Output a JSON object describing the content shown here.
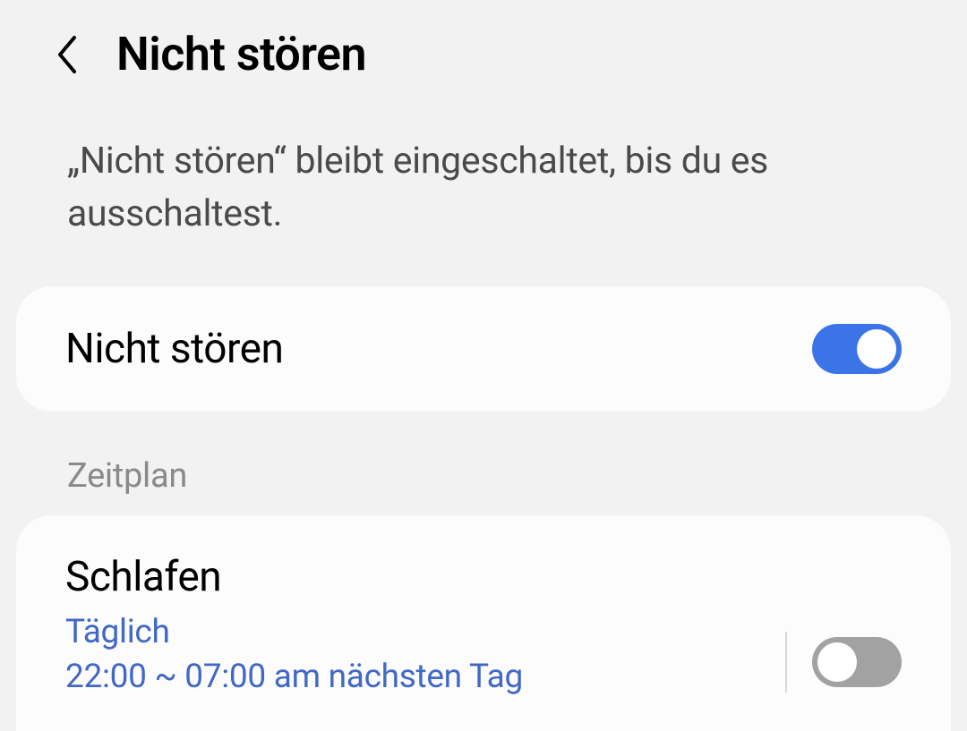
{
  "header": {
    "title": "Nicht stören"
  },
  "description": "„Nicht stören“ bleibt eingeschaltet, bis du es ausschaltest.",
  "main_toggle": {
    "label": "Nicht stören",
    "enabled": true
  },
  "section_label": "Zeitplan",
  "schedule": {
    "title": "Schlafen",
    "frequency": "Täglich",
    "time": "22:00 ~ 07:00 am nächsten Tag",
    "enabled": false
  }
}
